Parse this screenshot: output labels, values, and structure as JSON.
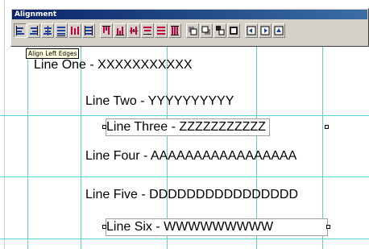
{
  "toolbar": {
    "title": "Alignment",
    "buttons": [
      {
        "icon": "align-left-edges-icon"
      },
      {
        "icon": "align-right-edges-icon"
      },
      {
        "icon": "align-horizontal-center-icon"
      },
      {
        "icon": "align-text-baseline-icon"
      },
      {
        "icon": "space-horizontally-icon"
      },
      {
        "icon": "make-same-width-icon"
      },
      {
        "icon": "align-top-edges-icon"
      },
      {
        "icon": "align-bottom-edges-icon"
      },
      {
        "icon": "align-vertical-center-icon"
      },
      {
        "icon": "align-baseline-vertical-icon"
      },
      {
        "icon": "space-vertically-icon"
      },
      {
        "icon": "make-same-height-icon"
      },
      {
        "icon": "bring-to-front-icon"
      },
      {
        "icon": "send-to-back-icon"
      },
      {
        "icon": "make-same-size-icon"
      },
      {
        "icon": "size-to-fit-icon"
      },
      {
        "icon": "arrow-left-icon"
      },
      {
        "icon": "arrow-right-icon"
      },
      {
        "icon": "arrow-up-icon"
      }
    ],
    "accent_color": "#c00040"
  },
  "tooltip": {
    "text": "Align Left Edges"
  },
  "labels": [
    {
      "text": "Line One - XXXXXXXXXXX"
    },
    {
      "text": "Line Two - YYYYYYYYYY"
    },
    {
      "text": "Line Three - ZZZZZZZZZZZ"
    },
    {
      "text": "Line Four - AAAAAAAAAAAAAAAAA"
    },
    {
      "text": "Line Five - DDDDDDDDDDDDDDDD"
    },
    {
      "text": "Line Six - WWWWWWWWW"
    }
  ],
  "grid_color": "#5ad0d8"
}
